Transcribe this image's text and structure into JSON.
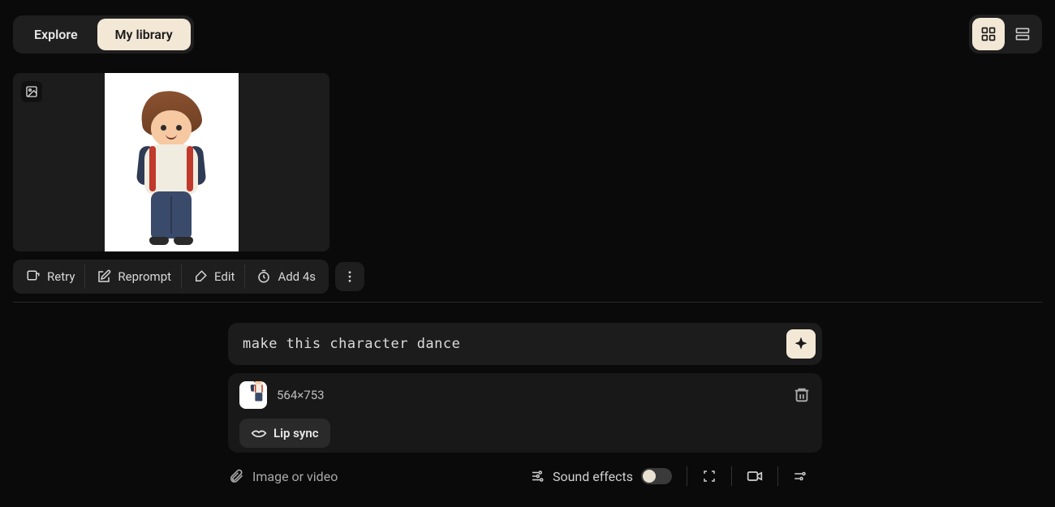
{
  "tabs": {
    "explore": "Explore",
    "library": "My library"
  },
  "actions": {
    "retry": "Retry",
    "reprompt": "Reprompt",
    "edit": "Edit",
    "add4s": "Add 4s"
  },
  "prompt": {
    "text": "make this character dance"
  },
  "attachment": {
    "dimensions": "564×753",
    "lipsync": "Lip sync"
  },
  "bottom": {
    "attach": "Image or video",
    "soundfx": "Sound effects"
  }
}
